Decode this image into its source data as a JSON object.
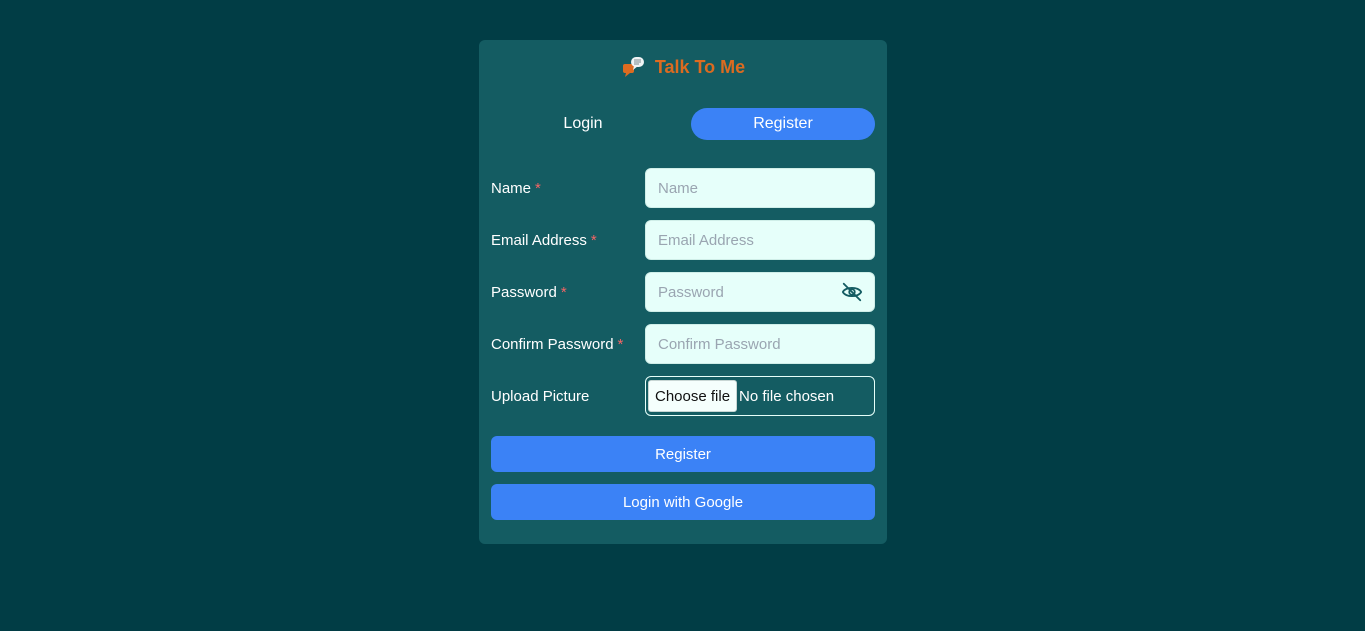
{
  "brand": {
    "title": "Talk To Me",
    "logo_icon": "chat-bubbles-icon"
  },
  "tabs": [
    {
      "label": "Login",
      "active": false
    },
    {
      "label": "Register",
      "active": true
    }
  ],
  "form": {
    "name": {
      "label": "Name",
      "required": "*",
      "placeholder": "Name",
      "value": ""
    },
    "email": {
      "label": "Email Address",
      "required": "*",
      "placeholder": "Email Address",
      "value": ""
    },
    "password": {
      "label": "Password",
      "required": "*",
      "placeholder": "Password",
      "value": "",
      "toggle_icon": "eye-off-icon"
    },
    "confirm_password": {
      "label": "Confirm Password",
      "required": "*",
      "placeholder": "Confirm Password",
      "value": ""
    },
    "picture": {
      "label": "Upload Picture",
      "button_label": "Choose file",
      "status": "No file chosen"
    }
  },
  "actions": {
    "register_label": "Register",
    "google_label": "Login with Google"
  },
  "colors": {
    "background": "#013d45",
    "card": "#145c62",
    "accent": "#3b82f6",
    "brand": "#dd6b20",
    "required": "#f56565",
    "input_bg": "#e6fffa"
  }
}
